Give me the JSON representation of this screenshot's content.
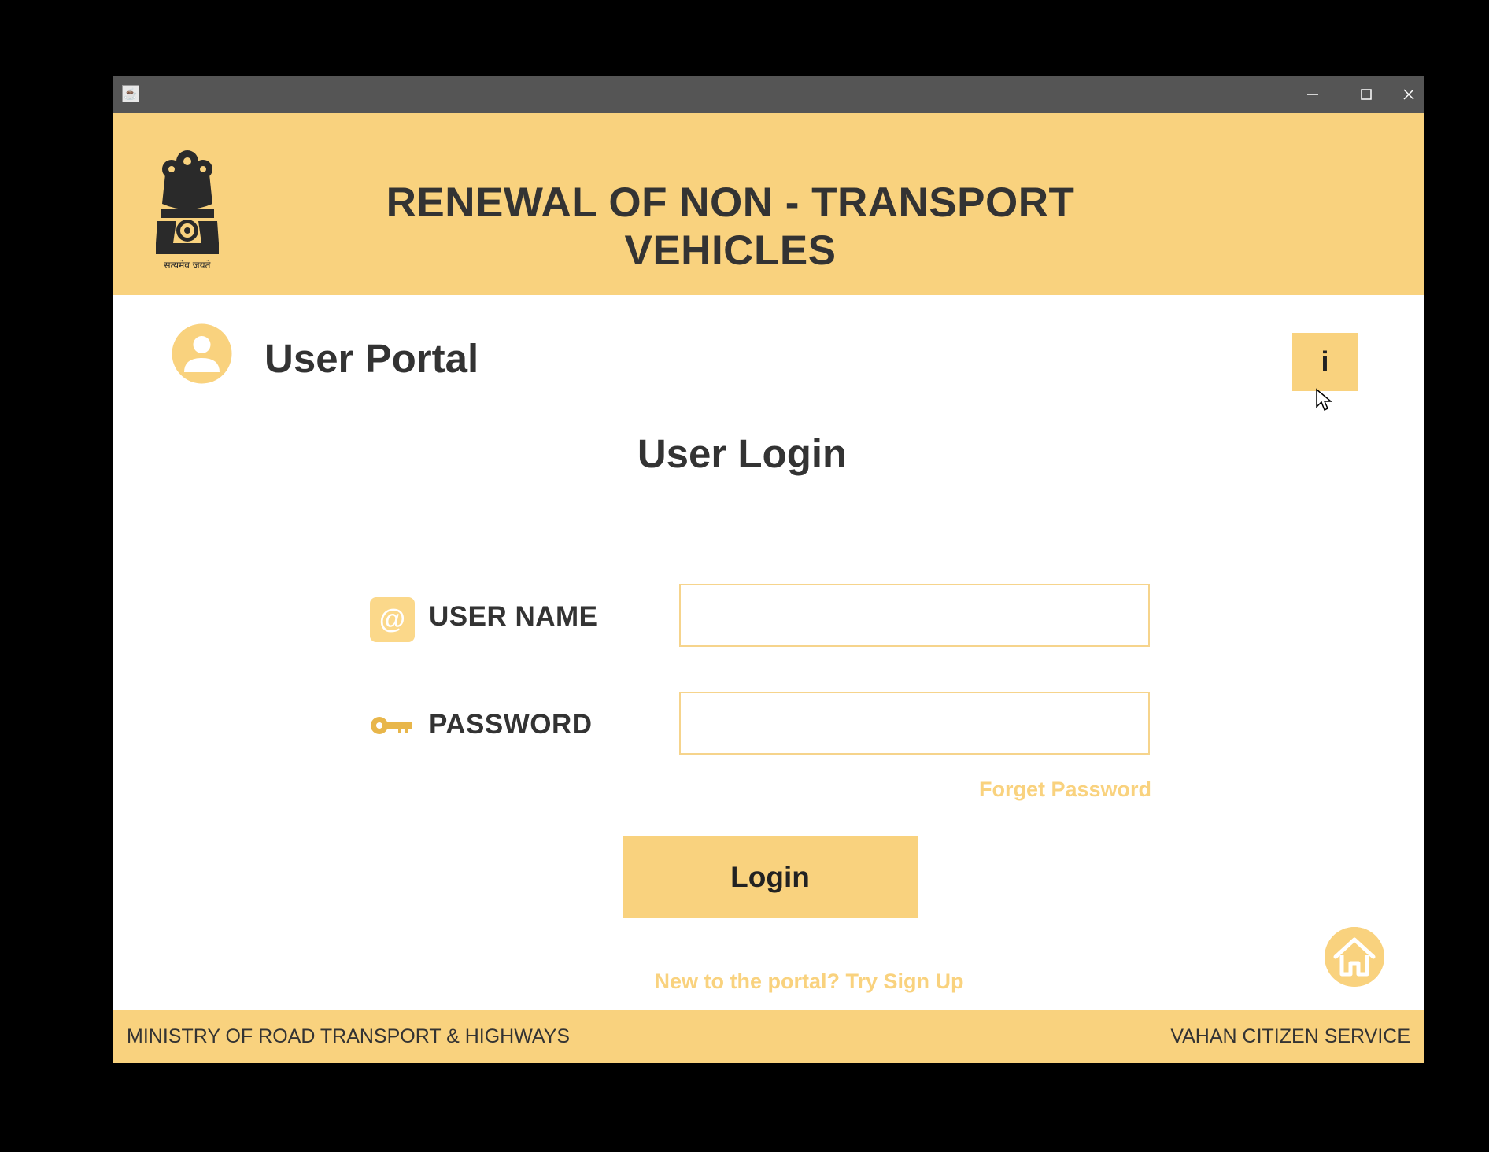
{
  "header": {
    "title": "RENEWAL OF NON - TRANSPORT VEHICLES",
    "emblem_motto": "सत्यमेव जयते"
  },
  "portal": {
    "title": "User Portal",
    "info_label": "i"
  },
  "login": {
    "title": "User Login",
    "username_label": "USER NAME",
    "password_label": "PASSWORD",
    "username_value": "",
    "password_value": "",
    "forget_password": "Forget Password",
    "button_label": "Login",
    "signup": "New to the portal? Try Sign Up"
  },
  "footer": {
    "left": "MINISTRY OF ROAD TRANSPORT & HIGHWAYS",
    "right": "VAHAN CITIZEN SERVICE"
  },
  "colors": {
    "accent": "#f9d27e",
    "titlebar": "#555555",
    "text": "#333333"
  },
  "icons": [
    "java-app-icon",
    "minimize-icon",
    "maximize-icon",
    "close-icon",
    "national-emblem",
    "user-avatar-icon",
    "at-icon",
    "key-icon",
    "home-icon",
    "mouse-cursor"
  ]
}
